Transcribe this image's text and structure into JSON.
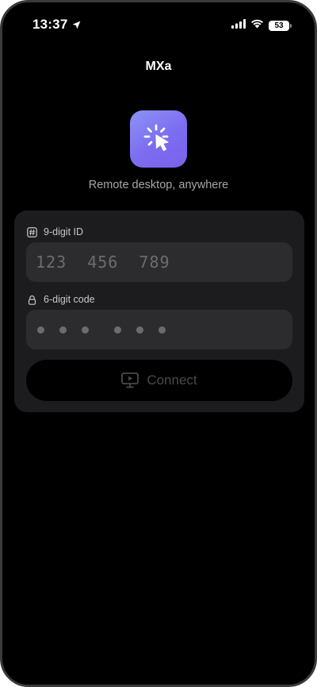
{
  "status_bar": {
    "time": "13:37",
    "battery_level": "53",
    "location_icon": "location-arrow-icon",
    "signal_icon": "cellular-signal-icon",
    "wifi_icon": "wifi-icon"
  },
  "app": {
    "title": "MXa",
    "logo_icon": "cursor-click-icon",
    "tagline": "Remote desktop, anywhere",
    "accent_gradient": [
      "#8c93f4",
      "#7a62ea"
    ]
  },
  "form": {
    "id_field": {
      "label": "9-digit ID",
      "icon": "hash-icon",
      "value": "",
      "placeholder": "123  456  789"
    },
    "code_field": {
      "label": "6-digit code",
      "icon": "lock-icon",
      "value": "",
      "placeholder_dots": 6
    },
    "connect_button": {
      "label": "Connect",
      "icon": "monitor-play-icon",
      "enabled": false
    }
  },
  "colors": {
    "background": "#000000",
    "card": "#1c1c1e",
    "input": "#2c2c2e",
    "muted_text": "#a6a6ab",
    "disabled_text": "#4a4a4e"
  }
}
